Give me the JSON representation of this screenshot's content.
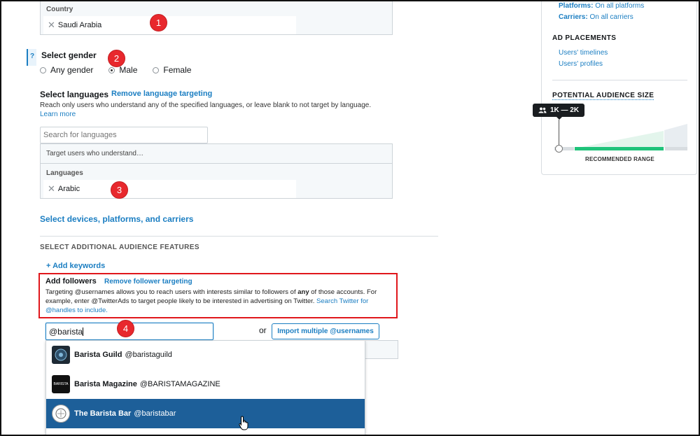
{
  "country": {
    "label": "Country",
    "value": "Saudi Arabia"
  },
  "gender": {
    "help": "?",
    "title": "Select gender",
    "options": [
      "Any gender",
      "Male",
      "Female"
    ],
    "selected": "Male"
  },
  "languages": {
    "title": "Select languages",
    "remove_link": "Remove language targeting",
    "description": "Reach only users who understand any of the specified languages, or leave blank to not target by language.",
    "learn_more": "Learn more",
    "search_placeholder": "Search for languages",
    "target_text": "Target users who understand…",
    "list_label": "Languages",
    "value": "Arabic"
  },
  "devices_link": "Select devices, platforms, and carriers",
  "additional": {
    "heading": "SELECT ADDITIONAL AUDIENCE FEATURES",
    "add_keywords": "+ Add keywords"
  },
  "followers": {
    "title": "Add followers",
    "remove_link": "Remove follower targeting",
    "desc_part1": "Targeting @usernames allows you to reach users with interests similar to followers of",
    "desc_bold": "any",
    "desc_part2": "of those accounts. For example, enter @TwitterAds to target people likely to be interested in advertising on Twitter.",
    "search_link": "Search Twitter for @handles to include.",
    "input_value": "@barista",
    "or_text": "or",
    "import_button": "Import multiple @usernames"
  },
  "suggestions": [
    {
      "name": "Barista Guild",
      "handle": "@baristaguild",
      "selected": false
    },
    {
      "name": "Barista Magazine",
      "handle": "@BARISTAMAGAZINE",
      "selected": false
    },
    {
      "name": "The Barista Bar",
      "handle": "@baristabar",
      "selected": true
    }
  ],
  "avatar_text": {
    "magazine": "BARISTA"
  },
  "badges": [
    "1",
    "2",
    "3",
    "4"
  ],
  "summary": {
    "platforms_label": "Platforms:",
    "platforms_value": "On all platforms",
    "carriers_label": "Carriers:",
    "carriers_value": "On all carriers",
    "placements_title": "AD PLACEMENTS",
    "placements": [
      "Users' timelines",
      "Users' profiles"
    ],
    "audience_title": "POTENTIAL AUDIENCE SIZE",
    "audience_range": "1K — 2K",
    "recommended": "RECOMMENDED RANGE"
  },
  "colors": {
    "link": "#1b7ec2",
    "badge": "#e8282d",
    "selected_row": "#1d5f99",
    "recommended": "#1fc37a",
    "highlight_border": "#e0171c"
  }
}
